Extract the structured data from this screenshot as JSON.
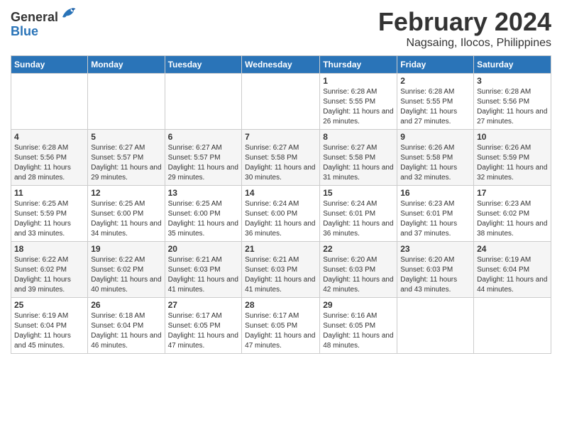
{
  "header": {
    "logo_general": "General",
    "logo_blue": "Blue",
    "month_title": "February 2024",
    "location": "Nagsaing, Ilocos, Philippines"
  },
  "weekdays": [
    "Sunday",
    "Monday",
    "Tuesday",
    "Wednesday",
    "Thursday",
    "Friday",
    "Saturday"
  ],
  "weeks": [
    [
      {
        "day": "",
        "info": ""
      },
      {
        "day": "",
        "info": ""
      },
      {
        "day": "",
        "info": ""
      },
      {
        "day": "",
        "info": ""
      },
      {
        "day": "1",
        "info": "Sunrise: 6:28 AM\nSunset: 5:55 PM\nDaylight: 11 hours and 26 minutes."
      },
      {
        "day": "2",
        "info": "Sunrise: 6:28 AM\nSunset: 5:55 PM\nDaylight: 11 hours and 27 minutes."
      },
      {
        "day": "3",
        "info": "Sunrise: 6:28 AM\nSunset: 5:56 PM\nDaylight: 11 hours and 27 minutes."
      }
    ],
    [
      {
        "day": "4",
        "info": "Sunrise: 6:28 AM\nSunset: 5:56 PM\nDaylight: 11 hours and 28 minutes."
      },
      {
        "day": "5",
        "info": "Sunrise: 6:27 AM\nSunset: 5:57 PM\nDaylight: 11 hours and 29 minutes."
      },
      {
        "day": "6",
        "info": "Sunrise: 6:27 AM\nSunset: 5:57 PM\nDaylight: 11 hours and 29 minutes."
      },
      {
        "day": "7",
        "info": "Sunrise: 6:27 AM\nSunset: 5:58 PM\nDaylight: 11 hours and 30 minutes."
      },
      {
        "day": "8",
        "info": "Sunrise: 6:27 AM\nSunset: 5:58 PM\nDaylight: 11 hours and 31 minutes."
      },
      {
        "day": "9",
        "info": "Sunrise: 6:26 AM\nSunset: 5:58 PM\nDaylight: 11 hours and 32 minutes."
      },
      {
        "day": "10",
        "info": "Sunrise: 6:26 AM\nSunset: 5:59 PM\nDaylight: 11 hours and 32 minutes."
      }
    ],
    [
      {
        "day": "11",
        "info": "Sunrise: 6:25 AM\nSunset: 5:59 PM\nDaylight: 11 hours and 33 minutes."
      },
      {
        "day": "12",
        "info": "Sunrise: 6:25 AM\nSunset: 6:00 PM\nDaylight: 11 hours and 34 minutes."
      },
      {
        "day": "13",
        "info": "Sunrise: 6:25 AM\nSunset: 6:00 PM\nDaylight: 11 hours and 35 minutes."
      },
      {
        "day": "14",
        "info": "Sunrise: 6:24 AM\nSunset: 6:00 PM\nDaylight: 11 hours and 36 minutes."
      },
      {
        "day": "15",
        "info": "Sunrise: 6:24 AM\nSunset: 6:01 PM\nDaylight: 11 hours and 36 minutes."
      },
      {
        "day": "16",
        "info": "Sunrise: 6:23 AM\nSunset: 6:01 PM\nDaylight: 11 hours and 37 minutes."
      },
      {
        "day": "17",
        "info": "Sunrise: 6:23 AM\nSunset: 6:02 PM\nDaylight: 11 hours and 38 minutes."
      }
    ],
    [
      {
        "day": "18",
        "info": "Sunrise: 6:22 AM\nSunset: 6:02 PM\nDaylight: 11 hours and 39 minutes."
      },
      {
        "day": "19",
        "info": "Sunrise: 6:22 AM\nSunset: 6:02 PM\nDaylight: 11 hours and 40 minutes."
      },
      {
        "day": "20",
        "info": "Sunrise: 6:21 AM\nSunset: 6:03 PM\nDaylight: 11 hours and 41 minutes."
      },
      {
        "day": "21",
        "info": "Sunrise: 6:21 AM\nSunset: 6:03 PM\nDaylight: 11 hours and 41 minutes."
      },
      {
        "day": "22",
        "info": "Sunrise: 6:20 AM\nSunset: 6:03 PM\nDaylight: 11 hours and 42 minutes."
      },
      {
        "day": "23",
        "info": "Sunrise: 6:20 AM\nSunset: 6:03 PM\nDaylight: 11 hours and 43 minutes."
      },
      {
        "day": "24",
        "info": "Sunrise: 6:19 AM\nSunset: 6:04 PM\nDaylight: 11 hours and 44 minutes."
      }
    ],
    [
      {
        "day": "25",
        "info": "Sunrise: 6:19 AM\nSunset: 6:04 PM\nDaylight: 11 hours and 45 minutes."
      },
      {
        "day": "26",
        "info": "Sunrise: 6:18 AM\nSunset: 6:04 PM\nDaylight: 11 hours and 46 minutes."
      },
      {
        "day": "27",
        "info": "Sunrise: 6:17 AM\nSunset: 6:05 PM\nDaylight: 11 hours and 47 minutes."
      },
      {
        "day": "28",
        "info": "Sunrise: 6:17 AM\nSunset: 6:05 PM\nDaylight: 11 hours and 47 minutes."
      },
      {
        "day": "29",
        "info": "Sunrise: 6:16 AM\nSunset: 6:05 PM\nDaylight: 11 hours and 48 minutes."
      },
      {
        "day": "",
        "info": ""
      },
      {
        "day": "",
        "info": ""
      }
    ]
  ]
}
